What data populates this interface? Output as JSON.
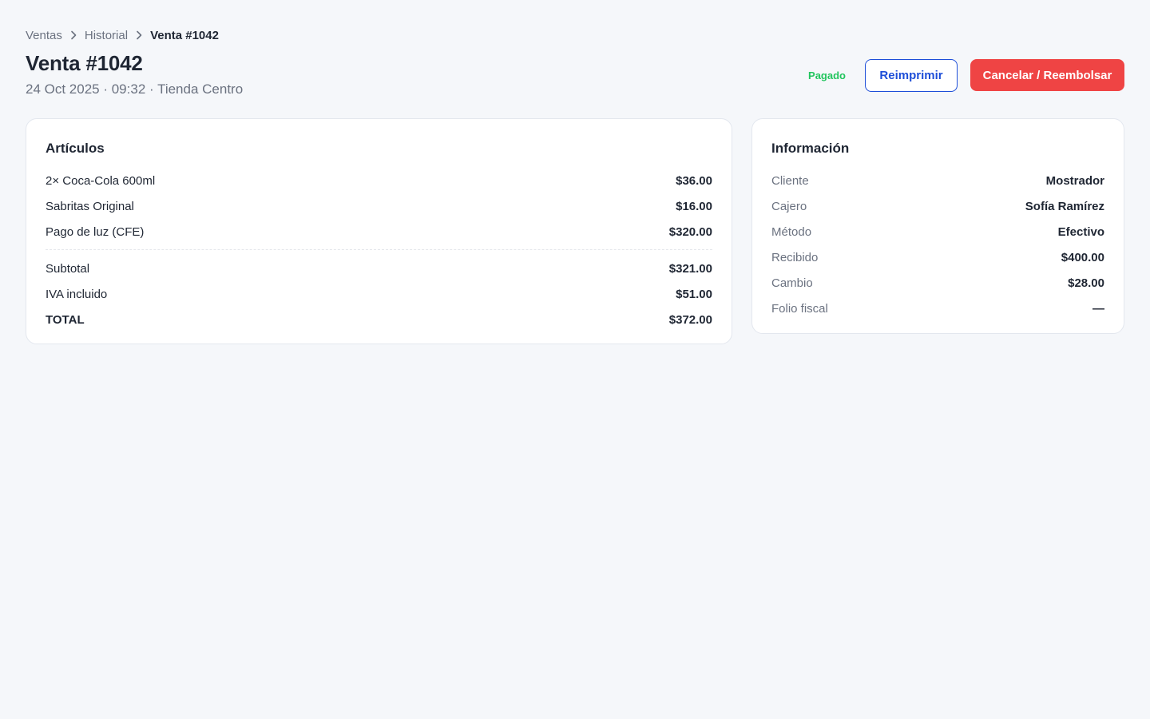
{
  "breadcrumb": {
    "items": [
      "Ventas",
      "Historial",
      "Venta #1042"
    ]
  },
  "header": {
    "title": "Venta #1042",
    "subtitle": "24 Oct 2025 · 09:32 · Tienda Centro",
    "status_badge": "Pagado",
    "reprint_label": "Reimprimir",
    "cancel_label": "Cancelar / Reembolsar"
  },
  "items_card": {
    "title": "Artículos",
    "items": [
      {
        "name": "2× Coca-Cola 600ml",
        "amount": "$36.00"
      },
      {
        "name": "Sabritas Original",
        "amount": "$16.00"
      },
      {
        "name": "Pago de luz (CFE)",
        "amount": "$320.00"
      }
    ],
    "subtotal_label": "Subtotal",
    "subtotal_value": "$321.00",
    "iva_label": "IVA incluido",
    "iva_value": "$51.00",
    "total_label": "TOTAL",
    "total_value": "$372.00"
  },
  "info_card": {
    "title": "Información",
    "rows": [
      {
        "label": "Cliente",
        "value": "Mostrador"
      },
      {
        "label": "Cajero",
        "value": "Sofía Ramírez"
      },
      {
        "label": "Método",
        "value": "Efectivo"
      },
      {
        "label": "Recibido",
        "value": "$400.00"
      },
      {
        "label": "Cambio",
        "value": "$28.00"
      },
      {
        "label": "Folio fiscal",
        "value": "—"
      }
    ]
  },
  "colors": {
    "background": "#f5f7fa",
    "primary_blue": "#1d4ed8",
    "danger_red": "#ef4444",
    "success_green": "#22c55e",
    "muted_text": "#6b7280"
  },
  "icons": {
    "breadcrumb_separator": "chevron-right-icon"
  }
}
